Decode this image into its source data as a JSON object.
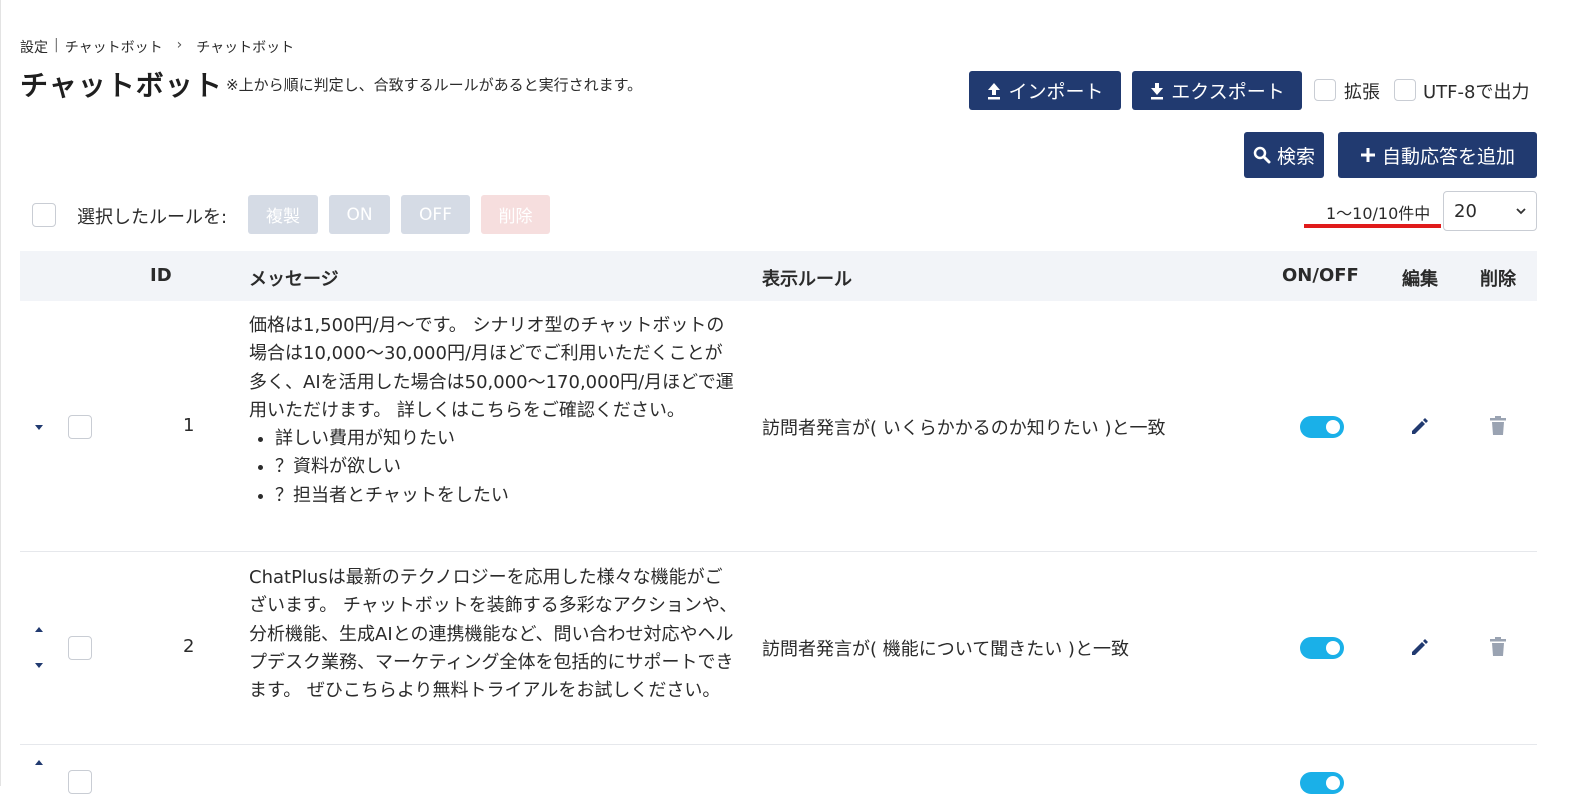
{
  "breadcrumb": {
    "root": "設定",
    "sep": "|",
    "parent": "チャットボット",
    "chevron": "›",
    "current": "チャットボット"
  },
  "page": {
    "title": "チャットボット",
    "note": "※上から順に判定し、合致するルールがあると実行されます。"
  },
  "toolbar": {
    "import_label": "インポート",
    "export_label": "エクスポート",
    "extend_label": "拡張",
    "utf8_label": "UTF-8で出力",
    "search_label": "検索",
    "add_label": "自動応答を追加"
  },
  "bulk": {
    "label": "選択したルールを:",
    "copy": "複製",
    "on": "ON",
    "off": "OFF",
    "delete": "削除"
  },
  "pagination": {
    "count_text": "1〜10/10件中",
    "page_size": "20"
  },
  "table": {
    "headers": {
      "id": "ID",
      "message": "メッセージ",
      "rule": "表示ルール",
      "onoff": "ON/OFF",
      "edit": "編集",
      "delete": "削除"
    },
    "rows": [
      {
        "id": "1",
        "message": "価格は1,500円/月〜です。 シナリオ型のチャットボットの場合は10,000〜30,000円/月ほどでご利用いただくことが多く、AIを活用した場合は50,000〜170,000円/月ほどで運用いただけます。 詳しくはこちらをご確認ください。",
        "options": [
          "詳しい費用が知りたい",
          "？資料が欲しい",
          "？担当者とチャットをしたい"
        ],
        "rule": "訪問者発言が( いくらかかるのか知りたい )と一致",
        "enabled": true
      },
      {
        "id": "2",
        "message": "ChatPlusは最新のテクノロジーを応用した様々な機能がございます。 チャットボットを装飾する多彩なアクションや、分析機能、生成AIとの連携機能など、問い合わせ対応やヘルプデスク業務、マーケティング全体を包括的にサポートできます。 ぜひこちらより無料トライアルをお試しください。",
        "rule": "訪問者発言が( 機能について聞きたい )と一致",
        "enabled": true
      }
    ]
  },
  "colors": {
    "navy": "#213a70",
    "toggle_on": "#1ab0e8",
    "underline": "#e01b1b"
  }
}
